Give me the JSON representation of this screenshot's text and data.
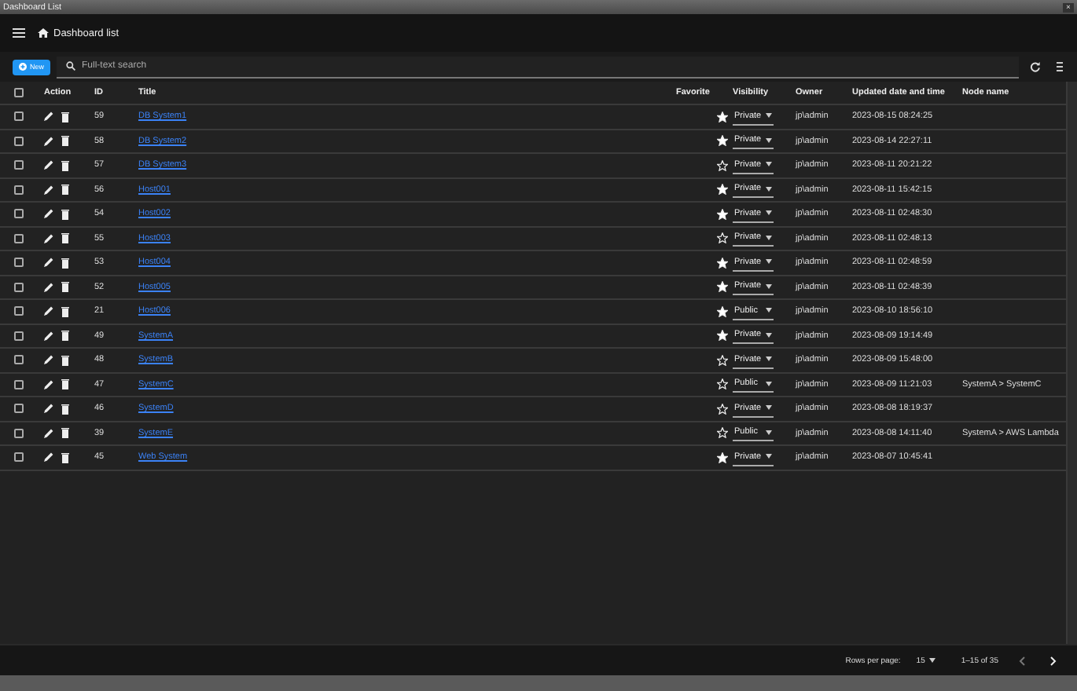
{
  "window": {
    "title": "Dashboard List",
    "close": "×"
  },
  "header": {
    "title": "Dashboard list"
  },
  "toolbar": {
    "new_button": "New",
    "search": {
      "placeholder": "Full-text search"
    }
  },
  "table": {
    "header_checked": false,
    "columns": [
      "Action",
      "ID",
      "Title",
      "Favorite",
      "Visibility",
      "Owner",
      "Updated date and time",
      "Node name"
    ],
    "rows": [
      {
        "id": "59",
        "title": "DB System1",
        "favorite": true,
        "visibility": "Private",
        "owner": "jp\\admin",
        "updated": "2023-08-15 08:24:25",
        "node": "",
        "selected": false
      },
      {
        "id": "58",
        "title": "DB System2",
        "favorite": true,
        "visibility": "Private",
        "owner": "jp\\admin",
        "updated": "2023-08-14 22:27:11",
        "node": "",
        "selected": false
      },
      {
        "id": "57",
        "title": "DB System3",
        "favorite": false,
        "visibility": "Private",
        "owner": "jp\\admin",
        "updated": "2023-08-11 20:21:22",
        "node": "",
        "selected": false
      },
      {
        "id": "56",
        "title": "Host001",
        "favorite": true,
        "visibility": "Private",
        "owner": "jp\\admin",
        "updated": "2023-08-11 15:42:15",
        "node": "",
        "selected": false
      },
      {
        "id": "54",
        "title": "Host002",
        "favorite": true,
        "visibility": "Private",
        "owner": "jp\\admin",
        "updated": "2023-08-11 02:48:30",
        "node": "",
        "selected": false
      },
      {
        "id": "55",
        "title": "Host003",
        "favorite": false,
        "visibility": "Private",
        "owner": "jp\\admin",
        "updated": "2023-08-11 02:48:13",
        "node": "",
        "selected": false
      },
      {
        "id": "53",
        "title": "Host004",
        "favorite": true,
        "visibility": "Private",
        "owner": "jp\\admin",
        "updated": "2023-08-11 02:48:59",
        "node": "",
        "selected": false
      },
      {
        "id": "52",
        "title": "Host005",
        "favorite": true,
        "visibility": "Private",
        "owner": "jp\\admin",
        "updated": "2023-08-11 02:48:39",
        "node": "",
        "selected": false
      },
      {
        "id": "21",
        "title": "Host006",
        "favorite": true,
        "visibility": "Public",
        "owner": "jp\\admin",
        "updated": "2023-08-10 18:56:10",
        "node": "",
        "selected": false
      },
      {
        "id": "49",
        "title": "SystemA",
        "favorite": true,
        "visibility": "Private",
        "owner": "jp\\admin",
        "updated": "2023-08-09 19:14:49",
        "node": "",
        "selected": false
      },
      {
        "id": "48",
        "title": "SystemB",
        "favorite": false,
        "visibility": "Private",
        "owner": "jp\\admin",
        "updated": "2023-08-09 15:48:00",
        "node": "",
        "selected": false
      },
      {
        "id": "47",
        "title": "SystemC",
        "favorite": false,
        "visibility": "Public",
        "owner": "jp\\admin",
        "updated": "2023-08-09 11:21:03",
        "node": "SystemA > SystemC",
        "selected": false
      },
      {
        "id": "46",
        "title": "SystemD",
        "favorite": false,
        "visibility": "Private",
        "owner": "jp\\admin",
        "updated": "2023-08-08 18:19:37",
        "node": "",
        "selected": false
      },
      {
        "id": "39",
        "title": "SystemE",
        "favorite": false,
        "visibility": "Public",
        "owner": "jp\\admin",
        "updated": "2023-08-08 14:11:40",
        "node": "SystemA > AWS Lambda",
        "selected": false
      },
      {
        "id": "45",
        "title": "Web System",
        "favorite": true,
        "visibility": "Private",
        "owner": "jp\\admin",
        "updated": "2023-08-07 10:45:41",
        "node": "",
        "selected": false
      }
    ]
  },
  "pagination": {
    "rows_per_page_label": "Rows per page:",
    "rows_per_page": "15",
    "range": "1–15 of 35"
  }
}
